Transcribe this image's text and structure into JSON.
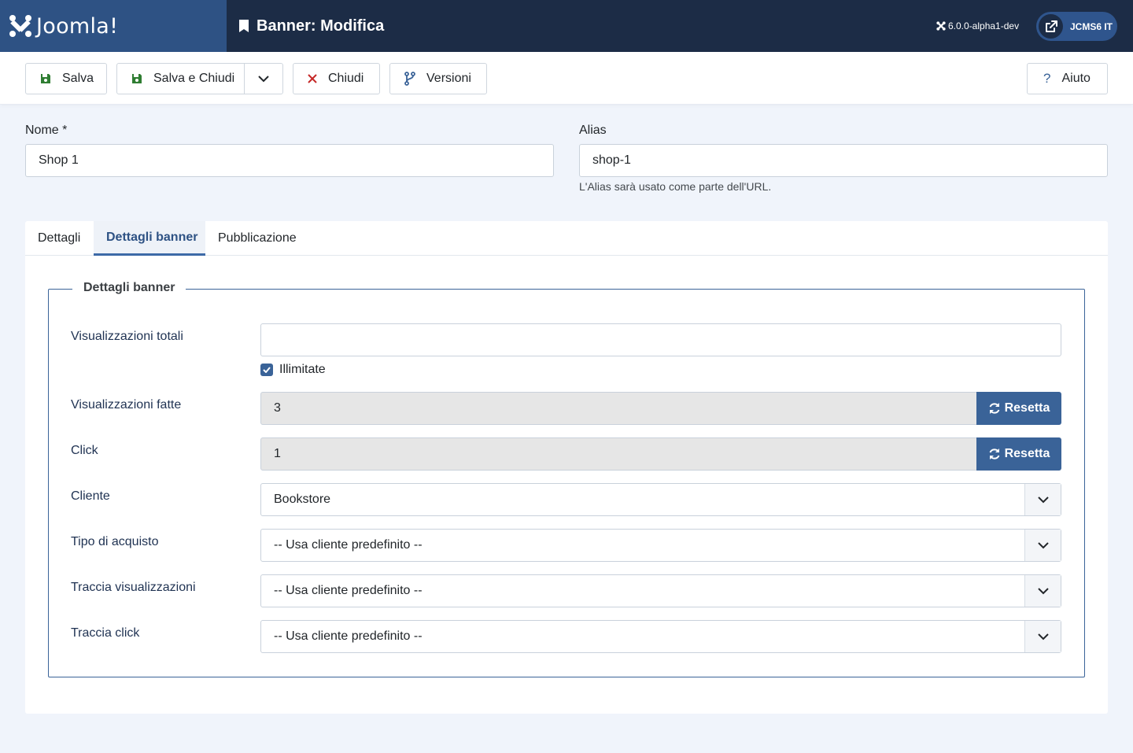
{
  "header": {
    "logo_text": "Joomla!",
    "page_title": "Banner: Modifica",
    "version": "6.0.0-alpha1-dev",
    "site_button": "JCMS6 IT"
  },
  "toolbar": {
    "save": "Salva",
    "save_close": "Salva e Chiudi",
    "close": "Chiudi",
    "versions": "Versioni",
    "help": "Aiuto"
  },
  "form": {
    "name_label": "Nome *",
    "name_value": "Shop 1",
    "alias_label": "Alias",
    "alias_value": "shop-1",
    "alias_hint": "L'Alias sarà usato come parte dell'URL."
  },
  "tabs": [
    {
      "label": "Dettagli"
    },
    {
      "label": "Dettagli banner"
    },
    {
      "label": "Pubblicazione"
    }
  ],
  "banner_details": {
    "legend": "Dettagli banner",
    "total_impressions_label": "Visualizzazioni totali",
    "total_impressions_value": "",
    "unlimited_label": "Illimitate",
    "unlimited_checked": true,
    "impressions_made_label": "Visualizzazioni fatte",
    "impressions_made_value": "3",
    "clicks_label": "Click",
    "clicks_value": "1",
    "reset_label": "Resetta",
    "client_label": "Cliente",
    "client_value": "Bookstore",
    "purchase_type_label": "Tipo di acquisto",
    "purchase_type_value": "-- Usa cliente predefinito --",
    "track_impressions_label": "Traccia visualizzazioni",
    "track_impressions_value": "-- Usa cliente predefinito --",
    "track_clicks_label": "Traccia click",
    "track_clicks_value": "-- Usa cliente predefinito --"
  },
  "colors": {
    "header_bg": "#1c2c46",
    "logo_bg": "#2e5284",
    "accent": "#3a6398",
    "save_icon": "#2f7d32",
    "close_icon": "#c52827"
  }
}
